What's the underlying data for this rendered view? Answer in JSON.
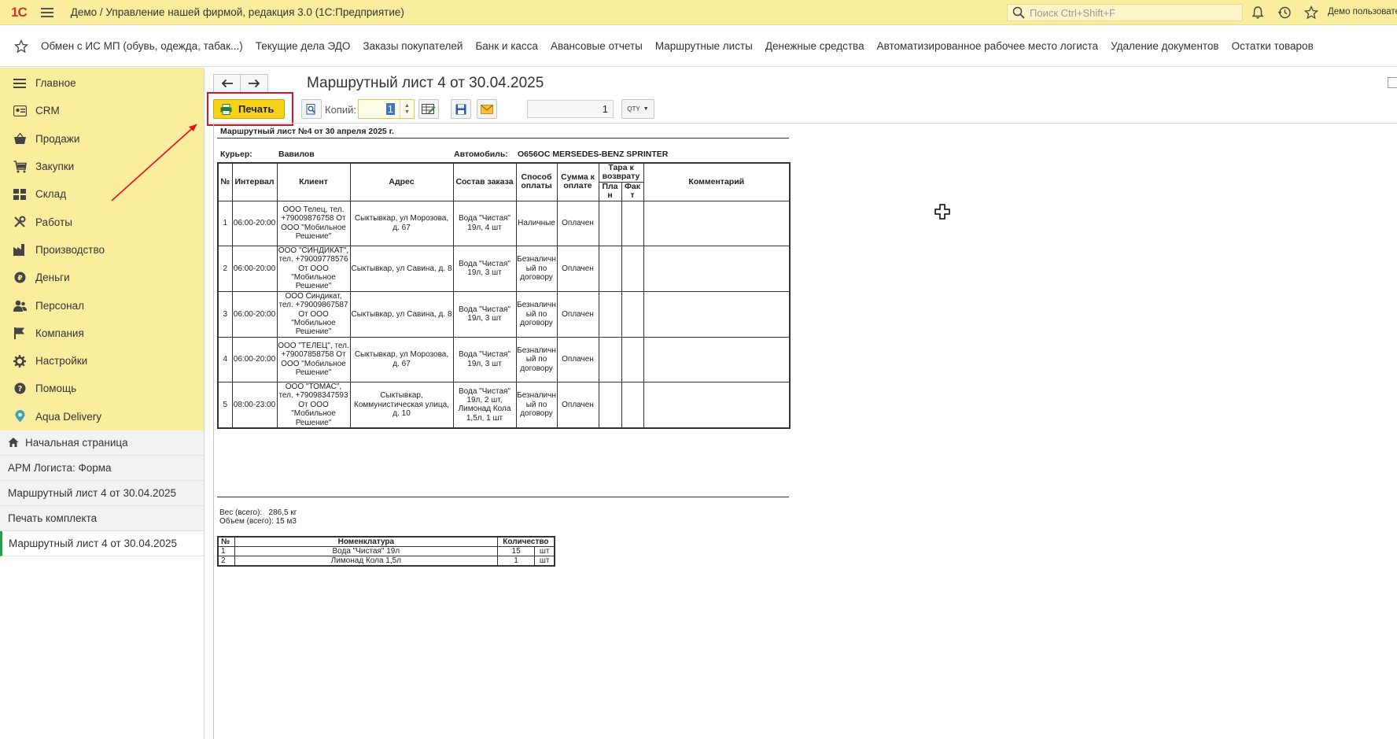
{
  "app": {
    "logo": "1С",
    "title": "Демо / Управление нашей фирмой, редакция 3.0  (1С:Предприятие)",
    "search_placeholder": "Поиск Ctrl+Shift+F",
    "user": "Демо пользовате"
  },
  "sections": [
    "Обмен с ИС МП (обувь, одежда, табак...)",
    "Текущие дела ЭДО",
    "Заказы покупателей",
    "Банк и касса",
    "Авансовые отчеты",
    "Маршрутные листы",
    "Денежные средства",
    "Автоматизированное рабочее место логиста",
    "Удаление документов",
    "Остатки товаров"
  ],
  "sidebar": {
    "nav": [
      {
        "label": "Главное",
        "icon": "menu-icon"
      },
      {
        "label": "CRM",
        "icon": "crm-icon"
      },
      {
        "label": "Продажи",
        "icon": "basket-icon"
      },
      {
        "label": "Закупки",
        "icon": "cart-icon"
      },
      {
        "label": "Склад",
        "icon": "warehouse-icon"
      },
      {
        "label": "Работы",
        "icon": "tools-icon"
      },
      {
        "label": "Производство",
        "icon": "factory-icon"
      },
      {
        "label": "Деньги",
        "icon": "ruble-icon"
      },
      {
        "label": "Персонал",
        "icon": "people-icon"
      },
      {
        "label": "Компания",
        "icon": "flag-icon"
      },
      {
        "label": "Настройки",
        "icon": "gear-icon"
      },
      {
        "label": "Помощь",
        "icon": "help-icon"
      },
      {
        "label": "Aqua Delivery",
        "icon": "location-icon"
      }
    ],
    "open_windows": [
      {
        "label": "Начальная страница",
        "home": true
      },
      {
        "label": "АРМ Логиста: Форма"
      },
      {
        "label": "Маршрутный лист 4 от 30.04.2025"
      },
      {
        "label": "Печать комплекта"
      },
      {
        "label": "Маршрутный лист 4 от 30.04.2025",
        "active": true
      }
    ]
  },
  "document": {
    "title": "Маршрутный лист 4 от 30.04.2025",
    "print_label": "Печать",
    "copies_label": "Копий:",
    "copies_value": "1",
    "pages_value": "1",
    "qty_label": "QTY"
  },
  "report": {
    "title": "Маршрутный лист №4 от 30 апреля 2025 г.",
    "courier_label": "Курьер:",
    "courier": "Вавилов",
    "car_label": "Автомобиль:",
    "car": "О656ОС MERSEDES-BENZ SPRINTER",
    "headers": {
      "num": "№",
      "interval": "Интервал",
      "client": "Клиент",
      "address": "Адрес",
      "order": "Состав заказа",
      "payment": "Способ оплаты",
      "sum": "Сумма к оплате",
      "tare": "Тара к возврату",
      "plan": "Пла н",
      "fact": "Фак т",
      "comment": "Комментарий"
    },
    "rows": [
      {
        "num": "1",
        "interval": "06:00-20:00",
        "client": "ООО Телец, тел. +79009876758 От ООО \"Мобильное Решение\"",
        "address": "Сыктывкар, ул Морозова, д. 67",
        "order": "Вода \"Чистая\" 19л, 4  шт",
        "payment": "Наличные",
        "sum": "Оплачен"
      },
      {
        "num": "2",
        "interval": "06:00-20:00",
        "client": "ООО \"СИНДИКАТ\", тел. +79009778576 От ООО \"Мобильное Решение\"",
        "address": "Сыктывкар, ул Савина, д. 8",
        "order": "Вода \"Чистая\" 19л, 3  шт",
        "payment": "Безналичн ый по договору",
        "sum": "Оплачен"
      },
      {
        "num": "3",
        "interval": "06:00-20:00",
        "client": "ООО Синдикат, тел. +79009867587 От ООО \"Мобильное Решение\"",
        "address": "Сыктывкар, ул Савина, д. 8",
        "order": "Вода \"Чистая\" 19л, 3  шт",
        "payment": "Безналичн ый по договору",
        "sum": "Оплачен"
      },
      {
        "num": "4",
        "interval": "06:00-20:00",
        "client": "ООО \"ТЕЛЕЦ\", тел. +79007858758 От ООО \"Мобильное Решение\"",
        "address": "Сыктывкар, ул Морозова, д. 67",
        "order": "Вода \"Чистая\" 19л, 3  шт",
        "payment": "Безналичн ый по договору",
        "sum": "Оплачен"
      },
      {
        "num": "5",
        "interval": "08:00-23:00",
        "client": "ООО \"ТОМАС\", тел. +79098347593 От ООО \"Мобильное Решение\"",
        "address": "Сыктывкар, Коммунистическая улица, д. 10",
        "order": "Вода \"Чистая\" 19л, 2  шт, Лимонад Кола 1,5л, 1  шт",
        "payment": "Безналичн ый по договору",
        "sum": "Оплачен"
      }
    ],
    "weight": "Вес (всего):   286,5 кг",
    "volume": "Объем (всего): 15 м3",
    "nom_headers": {
      "num": "№",
      "name": "Номенклатура",
      "qty": "Количество"
    },
    "nom_rows": [
      {
        "num": "1",
        "name": "Вода \"Чистая\" 19л",
        "qty": "15",
        "unit": "шт"
      },
      {
        "num": "2",
        "name": "Лимонад Кола 1,5л",
        "qty": "1",
        "unit": "шт"
      }
    ]
  },
  "colors": {
    "sidebar_bg": "#fbed9e",
    "print_button": "#f8d21a",
    "highlight_box": "#e0101f",
    "active_marker": "#2a9d4a"
  }
}
